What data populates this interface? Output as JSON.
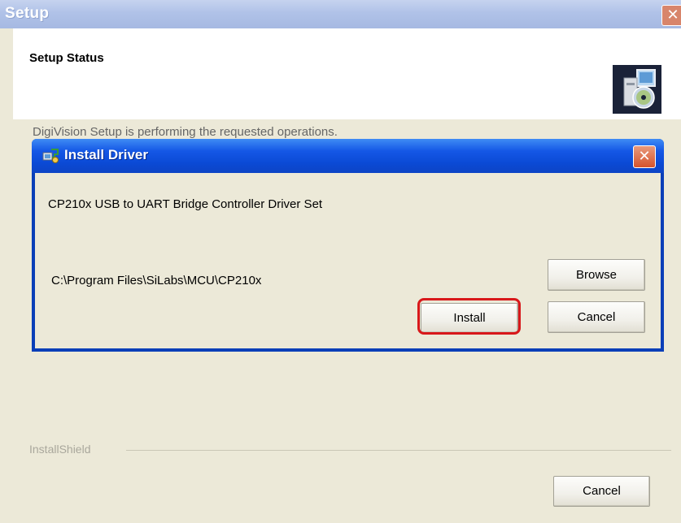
{
  "outer_window": {
    "title": "Setup",
    "close_glyph": "✕",
    "header_title": "Setup Status",
    "status_text": "DigiVision Setup is performing the requested operations.",
    "brand": "InstallShield",
    "cancel_label": "Cancel"
  },
  "dialog": {
    "title": "Install Driver",
    "close_glyph": "✕",
    "driver_name": "CP210x USB to UART Bridge Controller Driver Set",
    "install_path": "C:\\Program Files\\SiLabs\\MCU\\CP210x",
    "browse_label": "Browse",
    "install_label": "Install",
    "cancel_label": "Cancel"
  },
  "icons": {
    "header_icon": "setup-cd-computer-icon",
    "dialog_icon": "driver-install-icon"
  },
  "colors": {
    "dialog_titlebar": "#0b4ad6",
    "outer_titlebar": "#b0c2e8",
    "highlight": "#d8181a",
    "face": "#ece9d8"
  }
}
